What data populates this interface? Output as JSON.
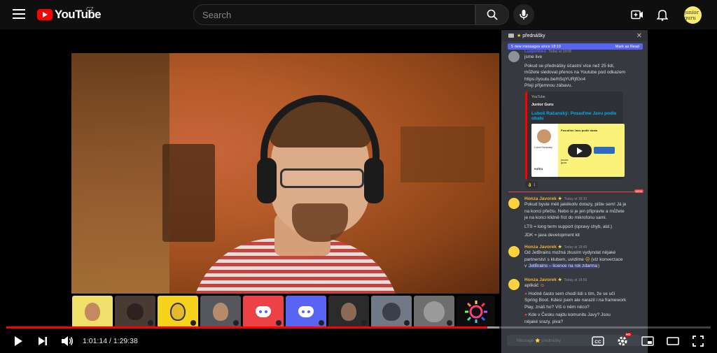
{
  "header": {
    "logo_text": "YouTube",
    "country": "CZ",
    "search_placeholder": "Search",
    "avatar_text": "junior guru"
  },
  "chat": {
    "channel": "přednášky",
    "new_messages": "5 new messages since 18:10",
    "mark_read": "Mark as Read",
    "messages": [
      {
        "name": "Luqunties",
        "time": "Today at 18:08",
        "lines": [
          "jsme live"
        ]
      },
      {
        "name": "",
        "time": "",
        "lines": [
          "Pokud se přednášky účastní více než 25 lidí,",
          "můžete sledovat přenos na Youtube pod odkazem"
        ],
        "link": "https://youtu.be/hSqYURjfGn4",
        "after": "Přeji příjemnou zábavu."
      },
      {
        "name": "Honza Javorek",
        "time": "Today at 18:10",
        "lines": [
          "Pokud byste měli jakékoliv dotazy, pište sem! Já je",
          "na konci přečtu. Nebo si je jen připravte a můžete",
          "je na konci klidně říct do mikrofonu sami.",
          "LTS = long term support (opravy chyb, atd.)",
          "JDK = java development kit"
        ]
      },
      {
        "name": "Honza Javorek",
        "time": "Today at 18:49",
        "lines": [
          "Od JetBrains možná zkusím vydyndat nějaké",
          "partnerství s klubem, uvidíme"
        ],
        "mention_pre": "(viz konverzace",
        "mention_v": "v",
        "mention": "JetBrains – licence na rok zdarma"
      },
      {
        "name": "Honza Javorek",
        "time": "Today at 18:59",
        "lines": [
          "aplikáč"
        ],
        "quote1": [
          "Hodně často sem chodí lidi s tím, že se učí",
          "Spring Boot. Kdesi jsem ale narazil i na framework",
          "Play, znáš ho? Víš o něm něco?"
        ],
        "quote2": [
          "Kde v Česku najdu komunitu Javy? Jsou",
          "nějaké srazy, piva?"
        ]
      }
    ],
    "embed": {
      "provider": "YouTube",
      "author": "Junior Guru",
      "title": "Luboš Račanský: Posuďme Javu podle obalu",
      "thumb_title": "Posuďme Javu podle obalu",
      "thumb_name": "Luboš Račanský",
      "thumb_company": "eultra",
      "thumb_logo": "junior guru"
    },
    "reaction": "1",
    "new_badge": "NEW",
    "input_placeholder": "Message ⭐ přednášky"
  },
  "player": {
    "current_time": "1:01:14",
    "duration": "1:29:38",
    "time_separator": " / ",
    "progress_played": 0.683,
    "progress_loaded": 0.7,
    "hd_badge": "HD"
  },
  "colors": {
    "accent": "#ff0000",
    "discord_blurple": "#5865f2",
    "chat_bg": "#36393f",
    "author_gold": "#f0b232"
  },
  "icons": {
    "menu": "hamburger-icon",
    "search": "search-icon",
    "mic": "mic-icon",
    "create": "create-video-icon",
    "notifications": "bell-icon",
    "play": "play-icon",
    "next": "next-icon",
    "volume": "volume-icon",
    "captions": "captions-icon",
    "settings": "gear-icon",
    "miniplayer": "miniplayer-icon",
    "theater": "theater-icon",
    "fullscreen": "fullscreen-icon"
  }
}
